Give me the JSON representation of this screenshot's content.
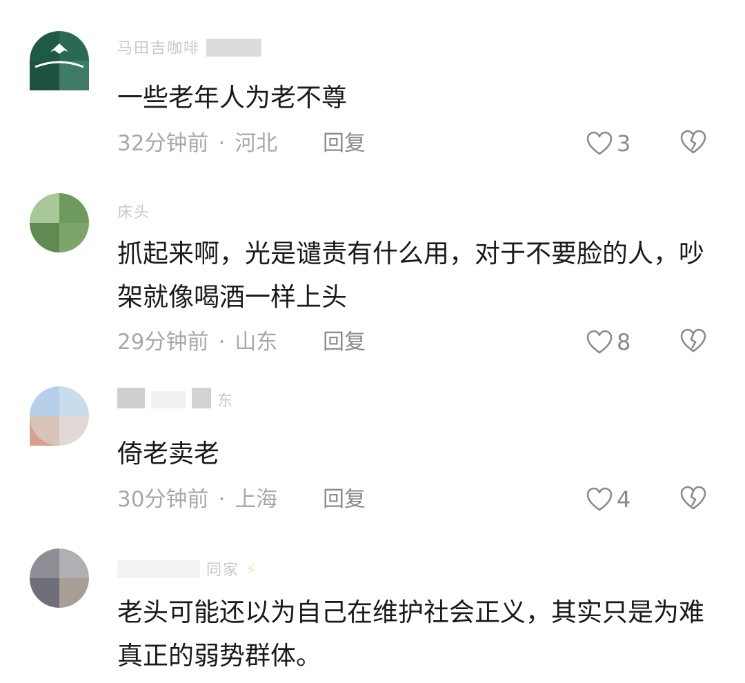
{
  "comments": [
    {
      "text": "一些老年人为老不尊",
      "time": "32分钟前",
      "location": "河北",
      "reply_label": "回复",
      "likes": "3",
      "username": "马田吉咖啡"
    },
    {
      "text": "抓起来啊，光是谴责有什么用，对于不要脸的人，吵架就像喝酒一样上头",
      "time": "29分钟前",
      "location": "山东",
      "reply_label": "回复",
      "likes": "8",
      "username": "床头"
    },
    {
      "text": "倚老卖老",
      "time": "30分钟前",
      "location": "上海",
      "reply_label": "回复",
      "likes": "4",
      "username": "东"
    },
    {
      "text": "老头可能还以为自己在维护社会正义，其实只是为难真正的弱势群体。",
      "username": "同家"
    }
  ],
  "separator": "·",
  "colors": {
    "text": "#1a1a1a",
    "meta": "#a8a8a8",
    "icon": "#8a8a8a",
    "background": "#ffffff"
  },
  "icons": {
    "like": "heart-outline-icon",
    "dislike": "broken-heart-icon",
    "badge": "lightning-icon"
  }
}
